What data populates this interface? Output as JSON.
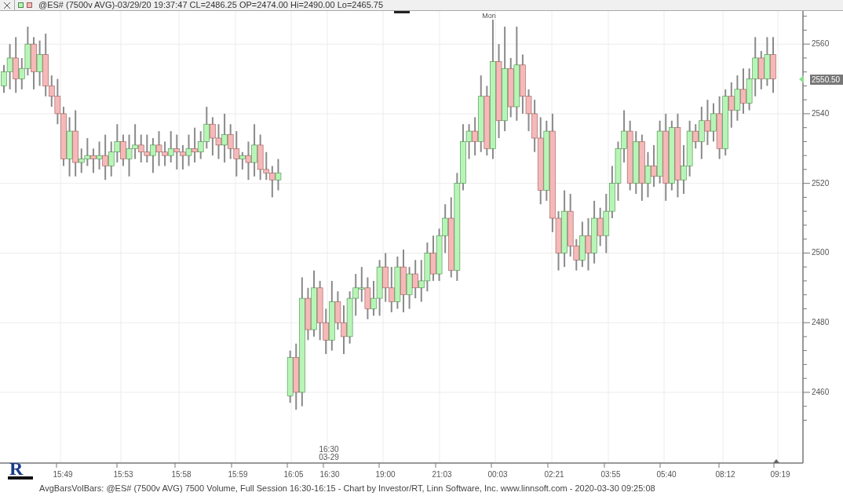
{
  "title_bar": {
    "text": "@ES# (7500v AVG)-03/29/20 19:37:47 CL=2486.25 OP=2474.00 Hi=2490.00 Lo=2465.75"
  },
  "chart": {
    "day_label": "Mon",
    "session_label": [
      "16:30",
      "03-29"
    ],
    "current_price": "2550.50",
    "time_ticks": [
      "15:49",
      "15:53",
      "15:58",
      "15:59",
      "16:05",
      "16:30",
      "19:00",
      "21:03",
      "00:03",
      "02:21",
      "03:55",
      "05:40",
      "08:12",
      "09:19"
    ],
    "chart_data": {
      "type": "candlestick",
      "ylim": [
        2439.7,
        2569.5
      ],
      "grid": true,
      "yticks": [
        2560,
        2540,
        2520,
        2500,
        2480,
        2460
      ],
      "ohlc": [
        [
          2548,
          2554,
          2546,
          2552
        ],
        [
          2552,
          2560,
          2547,
          2556
        ],
        [
          2556,
          2562,
          2546,
          2550
        ],
        [
          2550,
          2556,
          2547,
          2553
        ],
        [
          2553,
          2565,
          2551,
          2560
        ],
        [
          2560,
          2562,
          2547,
          2552
        ],
        [
          2552,
          2561,
          2548,
          2557
        ],
        [
          2557,
          2563,
          2545,
          2548
        ],
        [
          2548,
          2551,
          2542,
          2545
        ],
        [
          2545,
          2550,
          2537,
          2540
        ],
        [
          2540,
          2542,
          2525,
          2527
        ],
        [
          2527,
          2539,
          2522,
          2535
        ],
        [
          2535,
          2541,
          2522,
          2526
        ],
        [
          2526,
          2530,
          2523,
          2527
        ],
        [
          2527,
          2533,
          2525,
          2528
        ],
        [
          2528,
          2530,
          2523,
          2527
        ],
        [
          2527,
          2532,
          2524,
          2528
        ],
        [
          2528,
          2534,
          2521,
          2525
        ],
        [
          2525,
          2532,
          2522,
          2529
        ],
        [
          2529,
          2537,
          2526,
          2532
        ],
        [
          2532,
          2534,
          2525,
          2527
        ],
        [
          2527,
          2534,
          2522,
          2530
        ],
        [
          2530,
          2537,
          2527,
          2531
        ],
        [
          2531,
          2534,
          2526,
          2529
        ],
        [
          2529,
          2534,
          2526,
          2528
        ],
        [
          2528,
          2533,
          2523,
          2531
        ],
        [
          2531,
          2535,
          2525,
          2529
        ],
        [
          2529,
          2532,
          2525,
          2528
        ],
        [
          2528,
          2535,
          2526,
          2530
        ],
        [
          2530,
          2534,
          2524,
          2529
        ],
        [
          2529,
          2531,
          2524,
          2528
        ],
        [
          2528,
          2534,
          2525,
          2530
        ],
        [
          2530,
          2536,
          2526,
          2529
        ],
        [
          2529,
          2535,
          2527,
          2532
        ],
        [
          2532,
          2542,
          2530,
          2537
        ],
        [
          2537,
          2539,
          2528,
          2533
        ],
        [
          2533,
          2537,
          2527,
          2531
        ],
        [
          2531,
          2540,
          2526,
          2534
        ],
        [
          2534,
          2537,
          2527,
          2530
        ],
        [
          2530,
          2535,
          2522,
          2527
        ],
        [
          2527,
          2529,
          2524,
          2528
        ],
        [
          2528,
          2532,
          2521,
          2526
        ],
        [
          2526,
          2537,
          2522,
          2531
        ],
        [
          2531,
          2534,
          2521,
          2524
        ],
        [
          2524,
          2529,
          2521,
          2523
        ],
        [
          2523,
          2525,
          2516,
          2521
        ],
        [
          2521,
          2527,
          2518,
          2523
        ],
        null,
        [
          2459,
          2472,
          2457,
          2470
        ],
        [
          2470,
          2474,
          2455,
          2460
        ],
        [
          2460,
          2493,
          2456,
          2487
        ],
        [
          2487,
          2490,
          2475,
          2478
        ],
        [
          2478,
          2495,
          2476,
          2490
        ],
        [
          2490,
          2492,
          2475,
          2480
        ],
        [
          2480,
          2484,
          2471,
          2475
        ],
        [
          2475,
          2492,
          2472,
          2486
        ],
        [
          2486,
          2489,
          2478,
          2480
        ],
        [
          2480,
          2485,
          2471,
          2476
        ],
        [
          2476,
          2489,
          2474,
          2487
        ],
        [
          2487,
          2494,
          2482,
          2490
        ],
        [
          2490,
          2496,
          2486,
          2490
        ],
        [
          2490,
          2493,
          2481,
          2484
        ],
        [
          2484,
          2492,
          2482,
          2487
        ],
        [
          2487,
          2498,
          2482,
          2496
        ],
        [
          2496,
          2500,
          2486,
          2490
        ],
        [
          2490,
          2496,
          2483,
          2486
        ],
        [
          2486,
          2499,
          2484,
          2496
        ],
        [
          2496,
          2501,
          2483,
          2488
        ],
        [
          2488,
          2496,
          2484,
          2494
        ],
        [
          2494,
          2498,
          2487,
          2490
        ],
        [
          2490,
          2498,
          2486,
          2492
        ],
        [
          2492,
          2503,
          2489,
          2500
        ],
        [
          2500,
          2505,
          2492,
          2494
        ],
        [
          2494,
          2507,
          2492,
          2505
        ],
        [
          2505,
          2514,
          2500,
          2510
        ],
        [
          2510,
          2516,
          2493,
          2495
        ],
        [
          2495,
          2523,
          2492,
          2520
        ],
        [
          2520,
          2537,
          2518,
          2532
        ],
        [
          2532,
          2537,
          2527,
          2535
        ],
        [
          2535,
          2539,
          2528,
          2532
        ],
        [
          2532,
          2551,
          2529,
          2545
        ],
        [
          2545,
          2548,
          2528,
          2530
        ],
        [
          2530,
          2567,
          2527,
          2555
        ],
        [
          2555,
          2560,
          2533,
          2538
        ],
        [
          2538,
          2565,
          2535,
          2553
        ],
        [
          2553,
          2556,
          2539,
          2542
        ],
        [
          2542,
          2565,
          2538,
          2554
        ],
        [
          2554,
          2557,
          2540,
          2545
        ],
        [
          2545,
          2547,
          2535,
          2540
        ],
        [
          2540,
          2544,
          2529,
          2533
        ],
        [
          2533,
          2539,
          2514,
          2518
        ],
        [
          2518,
          2538,
          2515,
          2535
        ],
        [
          2535,
          2540,
          2506,
          2510
        ],
        [
          2510,
          2512,
          2495,
          2500
        ],
        [
          2500,
          2518,
          2496,
          2512
        ],
        [
          2512,
          2517,
          2499,
          2502
        ],
        [
          2502,
          2504,
          2495,
          2498
        ],
        [
          2498,
          2509,
          2496,
          2505
        ],
        [
          2505,
          2510,
          2495,
          2500
        ],
        [
          2500,
          2515,
          2497,
          2510
        ],
        [
          2510,
          2513,
          2502,
          2505
        ],
        [
          2505,
          2517,
          2500,
          2512
        ],
        [
          2512,
          2525,
          2510,
          2520
        ],
        [
          2520,
          2532,
          2515,
          2530
        ],
        [
          2530,
          2541,
          2526,
          2535
        ],
        [
          2535,
          2538,
          2518,
          2520
        ],
        [
          2520,
          2535,
          2517,
          2532
        ],
        [
          2532,
          2534,
          2515,
          2520
        ],
        [
          2520,
          2529,
          2516,
          2525
        ],
        [
          2525,
          2531,
          2519,
          2522
        ],
        [
          2522,
          2538,
          2520,
          2535
        ],
        [
          2535,
          2540,
          2515,
          2520
        ],
        [
          2520,
          2538,
          2518,
          2536
        ],
        [
          2536,
          2540,
          2516,
          2521
        ],
        [
          2521,
          2531,
          2517,
          2525
        ],
        [
          2525,
          2538,
          2522,
          2535
        ],
        [
          2535,
          2537,
          2530,
          2532
        ],
        [
          2532,
          2542,
          2527,
          2538
        ],
        [
          2538,
          2544,
          2531,
          2535
        ],
        [
          2535,
          2543,
          2532,
          2540
        ],
        [
          2540,
          2545,
          2527,
          2530
        ],
        [
          2530,
          2547,
          2528,
          2545
        ],
        [
          2545,
          2549,
          2536,
          2541
        ],
        [
          2541,
          2551,
          2538,
          2547
        ],
        [
          2547,
          2553,
          2540,
          2543
        ],
        [
          2543,
          2553,
          2541,
          2550
        ],
        [
          2550,
          2562,
          2545,
          2556
        ],
        [
          2556,
          2558,
          2547,
          2550
        ],
        [
          2550,
          2562,
          2548,
          2557
        ],
        [
          2557,
          2562,
          2546,
          2550
        ]
      ]
    }
  },
  "logo": {
    "letter": "R"
  },
  "footer": {
    "text": "AvgBarsVolBars: @ES# (7500v AVG) 7500 Volume, Full Session 16:30-16:15 - Chart by Investor/RT, Linn Software, Inc. www.linnsoft.com - 2020-03-30 09:25:08"
  }
}
